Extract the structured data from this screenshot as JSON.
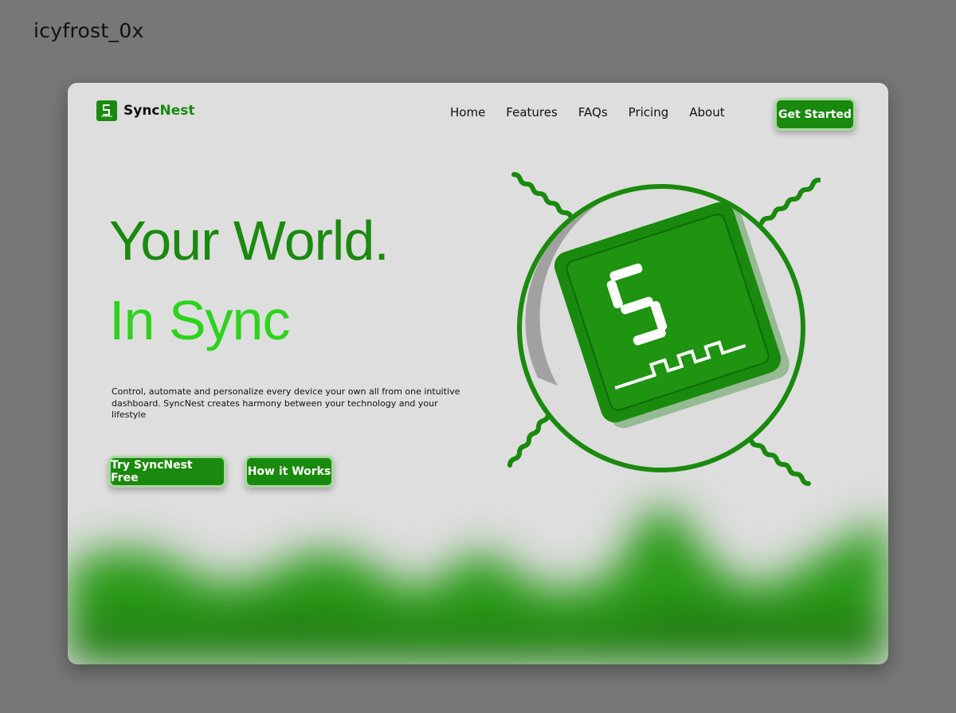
{
  "watermark": "icyfrost_0x",
  "brand": {
    "name_main": "Sync",
    "name_accent": "Nest",
    "logo_icon": "syncnest-logo-icon"
  },
  "nav": {
    "items": [
      "Home",
      "Features",
      "FAQs",
      "Pricing",
      "About"
    ],
    "cta": "Get Started"
  },
  "hero": {
    "title_line1": "Your World.",
    "title_line2": "In Sync",
    "description": "Control, automate and personalize every device your own  all from one intuitive dashboard. SyncNest creates harmony between your technology and your lifestyle",
    "primary_cta": "Try SyncNest Free",
    "secondary_cta": "How it Works",
    "illustration_icon": "syncnest-chip-icon"
  },
  "colors": {
    "brand_green": "#1a8a0e",
    "bright_green": "#2bd41a",
    "card_bg": "#dedede",
    "page_bg": "#777777"
  }
}
